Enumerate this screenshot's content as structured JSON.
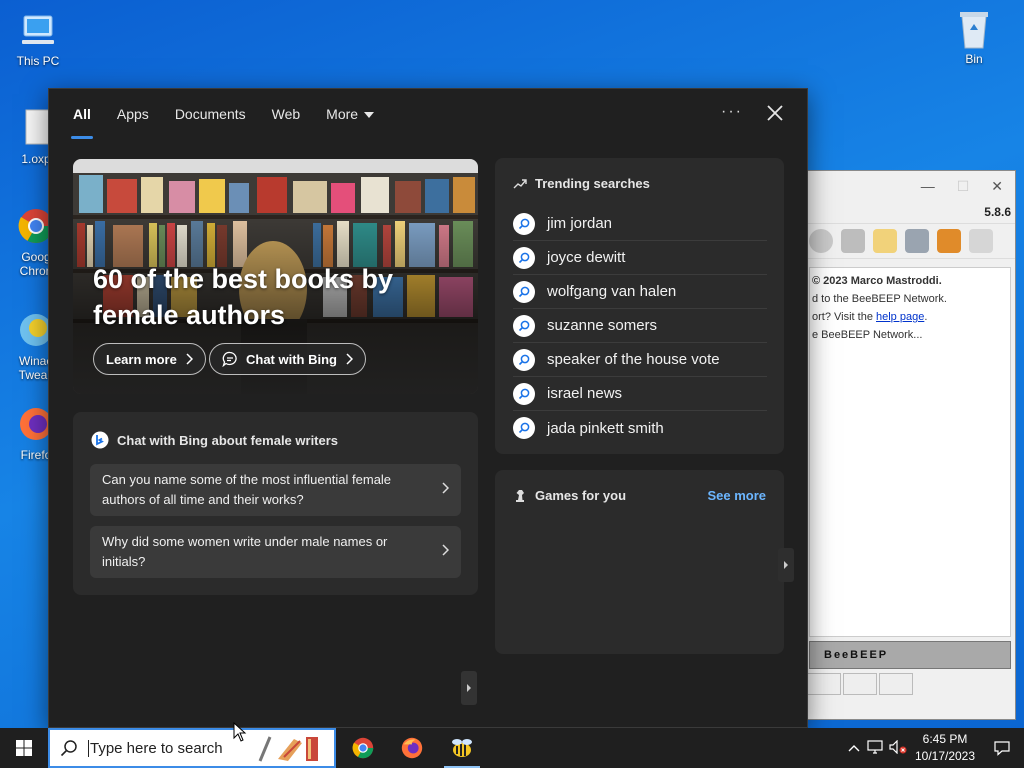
{
  "desktop": {
    "icons": [
      {
        "label": "This PC",
        "icon": "this-pc-icon"
      },
      {
        "label": "1.oxp",
        "icon": "file-icon"
      },
      {
        "label": "Goog Chron",
        "icon": "chrome-icon"
      },
      {
        "label": "Winae Tweak",
        "icon": "winaero-icon"
      },
      {
        "label": "Firefo",
        "icon": "firefox-icon"
      },
      {
        "label": "Bin",
        "icon": "recycle-bin-icon"
      }
    ]
  },
  "beebeep": {
    "version": "5.8.6",
    "lines": [
      "© 2023 Marco Mastroddi.",
      "d to the BeeBEEP Network.",
      "ort? Visit the ",
      "e BeeBEEP Network..."
    ],
    "help_link": "help page",
    "help_suffix": ".",
    "banner": "BeeBEEP"
  },
  "search_panel": {
    "tabs": [
      "All",
      "Apps",
      "Documents",
      "Web",
      "More"
    ],
    "more_icon": "ellipsis-icon",
    "close_icon": "close-icon",
    "hero": {
      "title": "60 of the best books by female authors",
      "learn_more": "Learn more",
      "chat_with_bing": "Chat with Bing"
    },
    "chat": {
      "heading": "Chat with Bing about female writers",
      "questions": [
        "Can you name some of the most influential female authors of all time and their works?",
        "Why did some women write under male names or initials?"
      ]
    },
    "trending": {
      "heading": "Trending searches",
      "items": [
        "jim jordan",
        "joyce dewitt",
        "wolfgang van halen",
        "suzanne somers",
        "speaker of the house vote",
        "israel news",
        "jada pinkett smith"
      ]
    },
    "games": {
      "heading": "Games for you",
      "see_more": "See more"
    }
  },
  "taskbar": {
    "search_placeholder": "Type here to search",
    "apps": [
      "chrome-icon",
      "firefox-icon",
      "beebeep-icon"
    ],
    "clock": {
      "time": "6:45 PM",
      "date": "10/17/2023"
    }
  },
  "colors": {
    "accent": "#3c8ce7",
    "panel_bg": "#202020",
    "card_bg": "#2b2b2b",
    "link": "#6cb6ff"
  }
}
